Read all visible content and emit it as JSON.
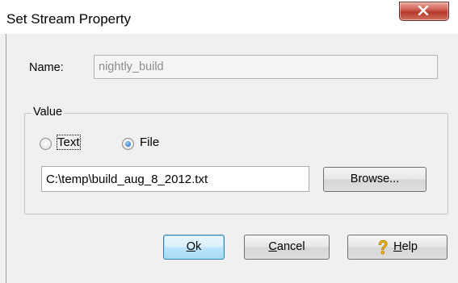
{
  "window": {
    "title": "Set Stream Property"
  },
  "name": {
    "label": "Name:",
    "value": "nightly_build"
  },
  "value_group": {
    "legend": "Value",
    "radio_text": {
      "label": "Text",
      "checked": false
    },
    "radio_file": {
      "label": "File",
      "checked": true
    },
    "path": "C:\\temp\\build_aug_8_2012.txt",
    "browse_label": "Browse..."
  },
  "buttons": {
    "ok_mnemonic": "O",
    "ok_rest": "k",
    "cancel_mnemonic": "C",
    "cancel_rest": "ancel",
    "help_mnemonic": "H",
    "help_rest": "elp"
  },
  "icons": {
    "close": "close-icon",
    "help": "question-mark-icon"
  }
}
